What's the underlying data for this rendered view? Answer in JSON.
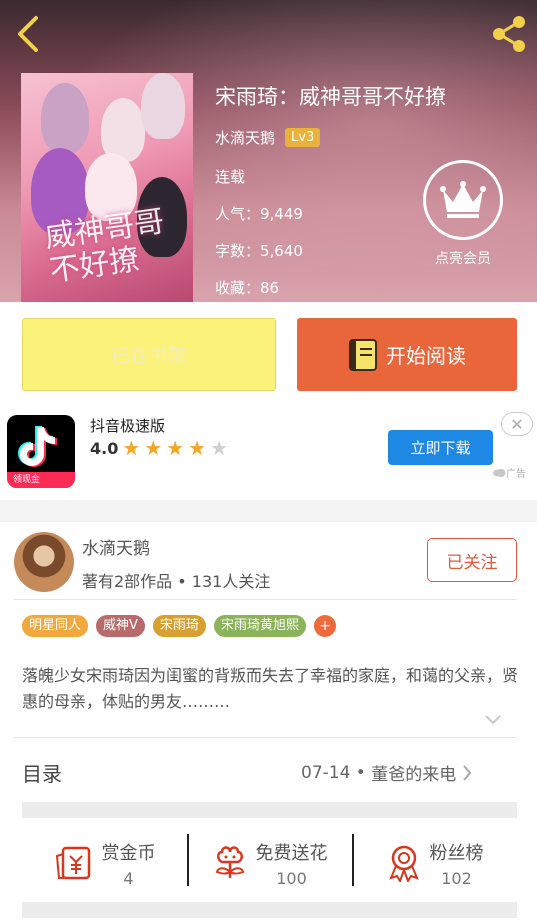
{
  "book": {
    "title": "宋雨琦：威神哥哥不好撩",
    "author": "水滴天鹅",
    "author_level": "Lv3",
    "status": "连载",
    "popularity": "人气：9,449",
    "word_count": "字数：5,640",
    "favorites": "收藏：86",
    "cover_title": "威神哥哥不好撩",
    "vip_label": "点亮会员"
  },
  "actions": {
    "on_shelf_label": "已在书架",
    "start_reading_label": "开始阅读"
  },
  "ad": {
    "app_name": "抖音极速版",
    "rating": "4.0",
    "stars_filled": 4,
    "stars_total": 5,
    "download_label": "立即下载",
    "badge_label": "广告",
    "icon_badge": "领现金"
  },
  "author_card": {
    "name": "水滴天鹅",
    "stats": "著有2部作品 • 131人关注",
    "follow_label": "已关注"
  },
  "tags": [
    {
      "label": "明星同人",
      "color": "#f2a83b"
    },
    {
      "label": "威神V",
      "color": "#b86b6b"
    },
    {
      "label": "宋雨琦",
      "color": "#d8a030"
    },
    {
      "label": "宋雨琦黄旭熙",
      "color": "#8bb35a"
    }
  ],
  "intro": "落魄少女宋雨琦因为闺蜜的背叛而失去了幸福的家庭，和蔼的父亲，贤惠的母亲，体贴的男友………",
  "toc": {
    "label": "目录",
    "latest_date": "07-14",
    "latest_chapter": "董爸的来电"
  },
  "stats": [
    {
      "label": "赏金币",
      "value": "4",
      "icon": "red-envelope-icon"
    },
    {
      "label": "免费送花",
      "value": "100",
      "icon": "flower-icon"
    },
    {
      "label": "粉丝榜",
      "value": "102",
      "icon": "medal-icon"
    }
  ],
  "colors": {
    "accent": "#e8663a",
    "shelf_button": "#fbf27a",
    "download_button": "#1e88e5",
    "back_icon": "#f2d04a"
  }
}
